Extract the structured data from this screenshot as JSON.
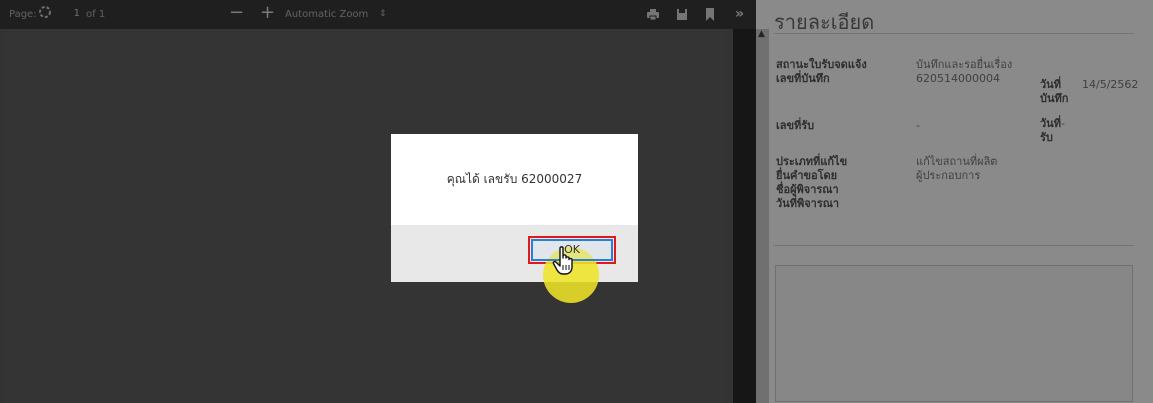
{
  "viewer": {
    "toolbar": {
      "page_label": "Page:",
      "page_value": "1",
      "page_of": "of 1",
      "zoom_out": "−",
      "zoom_in": "+",
      "zoom_level": "Automatic Zoom",
      "zoom_caret": "⇕",
      "more": "»"
    },
    "icons": [
      "spinner-icon",
      "print-icon",
      "save-icon",
      "bookmark-icon"
    ]
  },
  "panel": {
    "title": "รายละเอียด",
    "rows": [
      {
        "label": "สถานะใบรับจดแจ้ง",
        "value": "บันทึกและรอยื่นเรื่อง"
      },
      {
        "label": "เลขที่บันทึก",
        "value": "620514000004",
        "date_label": "วันที่บันทึก",
        "date_value": "14/5/2562"
      },
      {
        "label": "เลขที่รับ",
        "value": "-",
        "date_label": "วันที่รับ",
        "date_value": "-"
      },
      {
        "label": "ประเภทที่แก้ไข",
        "value": "แก้ไขสถานที่ผลิต"
      },
      {
        "label": "ยื่นคำขอโดย",
        "value": "ผู้ประกอบการ"
      },
      {
        "label": "ชื่อผู้พิจารณา",
        "value": ""
      },
      {
        "label": "วันที่พิจารณา",
        "value": ""
      }
    ]
  },
  "dialog": {
    "message": "คุณได้ เลขรับ 62000027",
    "ok_label": "OK"
  },
  "colors": {
    "toolbar_bg": "#3a3a3a",
    "highlight_border": "#e01a1a",
    "ok_border": "#2a7fd4",
    "cursor_glow": "#eee428"
  }
}
